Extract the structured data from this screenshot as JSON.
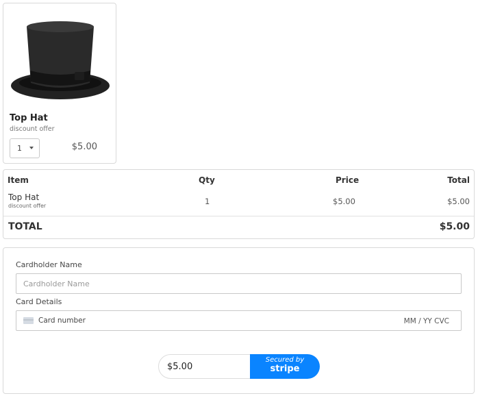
{
  "product": {
    "name": "Top Hat",
    "subtitle": "discount offer",
    "quantity": "1",
    "price": "$5.00",
    "image_icon": "top-hat-image"
  },
  "summary": {
    "headers": {
      "item": "Item",
      "qty": "Qty",
      "price": "Price",
      "total": "Total"
    },
    "rows": [
      {
        "name": "Top Hat",
        "subtitle": "discount offer",
        "qty": "1",
        "price": "$5.00",
        "total": "$5.00"
      }
    ],
    "total_label": "TOTAL",
    "total_value": "$5.00"
  },
  "payment": {
    "cardholder_label": "Cardholder Name",
    "cardholder_placeholder": "Cardholder Name",
    "card_details_label": "Card Details",
    "card_number_placeholder": "Card number",
    "expiry_cvc_placeholder": "MM / YY  CVC",
    "amount": "$5.00",
    "secured_by": "Secured by",
    "stripe_label": "stripe",
    "accent_color": "#0a84ff"
  }
}
